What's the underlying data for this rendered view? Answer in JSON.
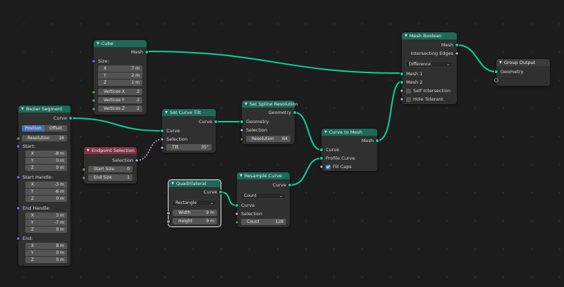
{
  "nodes": {
    "cube": {
      "title": "Cube",
      "output": "Mesh",
      "size_label": "Size:",
      "size_x": {
        "label": "X",
        "value": "7 m"
      },
      "size_y": {
        "label": "Y",
        "value": "2 m"
      },
      "size_z": {
        "label": "Z",
        "value": "1 m"
      },
      "vertices_x": {
        "label": "Vertices X",
        "value": "2"
      },
      "vertices_y": {
        "label": "Vertices Y",
        "value": "2"
      },
      "vertices_z": {
        "label": "Vertices Z",
        "value": "2"
      }
    },
    "bezier": {
      "title": "Bezier Segment",
      "output": "Curve",
      "mode_position": "Position",
      "mode_offset": "Offset",
      "resolution": {
        "label": "Resolution",
        "value": "16"
      },
      "start_label": "Start:",
      "start": [
        {
          "label": "X",
          "value": "-8 m"
        },
        {
          "label": "Y",
          "value": "0 m"
        },
        {
          "label": "Z",
          "value": "0 m"
        }
      ],
      "start_handle_label": "Start Handle:",
      "start_handle": [
        {
          "label": "X",
          "value": "-3 m"
        },
        {
          "label": "Y",
          "value": "-6 m"
        },
        {
          "label": "Z",
          "value": "0 m"
        }
      ],
      "end_handle_label": "End Handle:",
      "end_handle": [
        {
          "label": "X",
          "value": "3 m"
        },
        {
          "label": "Y",
          "value": "-7 m"
        },
        {
          "label": "Z",
          "value": "0 m"
        }
      ],
      "end_label": "End:",
      "end": [
        {
          "label": "X",
          "value": "8 m"
        },
        {
          "label": "Y",
          "value": "0 m"
        },
        {
          "label": "Z",
          "value": "0 m"
        }
      ]
    },
    "endpoint": {
      "title": "Endpoint Selection",
      "output": "Selection",
      "start_size": {
        "label": "Start Size",
        "value": "0"
      },
      "end_size": {
        "label": "End Size",
        "value": "1"
      }
    },
    "tilt": {
      "title": "Set Curve Tilt",
      "output": "Curve",
      "input_curve": "Curve",
      "input_selection": "Selection",
      "tilt": {
        "label": "Tilt",
        "value": "35°"
      }
    },
    "spline_res": {
      "title": "Set Spline Resolution",
      "output": "Geometry",
      "input_geometry": "Geometry",
      "input_selection": "Selection",
      "resolution": {
        "label": "Resolution",
        "value": "64"
      }
    },
    "quad": {
      "title": "Quadrilateral",
      "output": "Curve",
      "mode": "Rectangle",
      "width": {
        "label": "Width",
        "value": "9 m"
      },
      "height": {
        "label": "Height",
        "value": "9 m"
      }
    },
    "resample": {
      "title": "Resample Curve",
      "output": "Curve",
      "mode": "Count",
      "input_curve": "Curve",
      "input_selection": "Selection",
      "count": {
        "label": "Count",
        "value": "128"
      }
    },
    "to_mesh": {
      "title": "Curve to Mesh",
      "output": "Mesh",
      "input_curve": "Curve",
      "input_profile": "Profile Curve",
      "fill_caps": "Fill Caps"
    },
    "boolean": {
      "title": "Mesh Boolean",
      "output_mesh": "Mesh",
      "output_edges": "Intersecting Edges",
      "operation": "Difference",
      "input_mesh1": "Mesh 1",
      "input_mesh2": "Mesh 2",
      "self_intersection": "Self Intersection",
      "hole_tolerant": "Hole Tolerant"
    },
    "group_output": {
      "title": "Group Output",
      "input_geometry": "Geometry"
    }
  },
  "colors": {
    "geometry_header": "#1b6b58",
    "input_header": "#83314a",
    "geometry_socket": "#00d6a3",
    "field_link": "#cca6d6",
    "accent": "#4772b3"
  }
}
